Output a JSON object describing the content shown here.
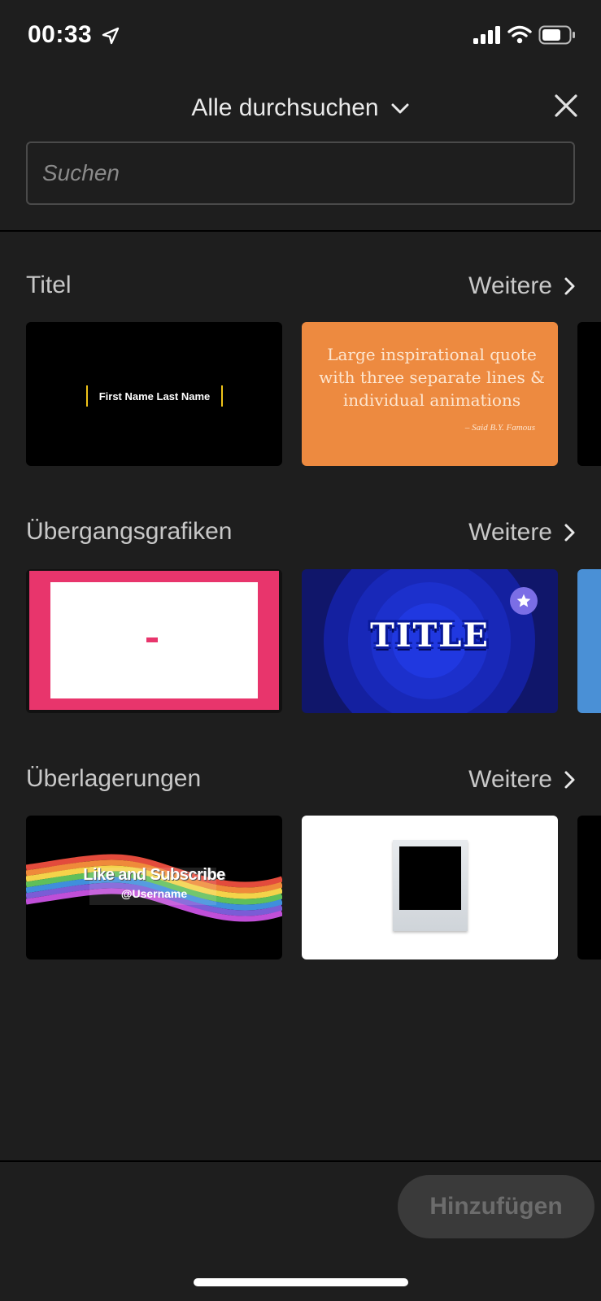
{
  "status_bar": {
    "time": "00:33"
  },
  "header": {
    "title": "Alle durchsuchen"
  },
  "search": {
    "placeholder": "Suchen",
    "value": ""
  },
  "sections": [
    {
      "title": "Titel",
      "more_label": "Weitere",
      "cards": [
        {
          "text": "First Name Last Name"
        },
        {
          "text": "Large inspirational quote with three separate lines & individual animations",
          "author": "– Said B.Y. Famous"
        }
      ]
    },
    {
      "title": "Übergangsgrafiken",
      "more_label": "Weitere",
      "cards": [
        {
          "text": ""
        },
        {
          "text": "TITLE",
          "badge_icon": "star-icon"
        }
      ]
    },
    {
      "title": "Überlagerungen",
      "more_label": "Weitere",
      "cards": [
        {
          "text": "Like and Subscribe",
          "subtext": "@Username"
        },
        {
          "text": ""
        }
      ]
    }
  ],
  "footer": {
    "add_label": "Hinzufügen"
  },
  "colors": {
    "background": "#1e1e1e",
    "accent_orange": "#ed8a40",
    "accent_pink": "#e8356c",
    "accent_blue": "#10166a",
    "peek_blue": "#4a90d6",
    "button_disabled": "#3a3a3a"
  }
}
